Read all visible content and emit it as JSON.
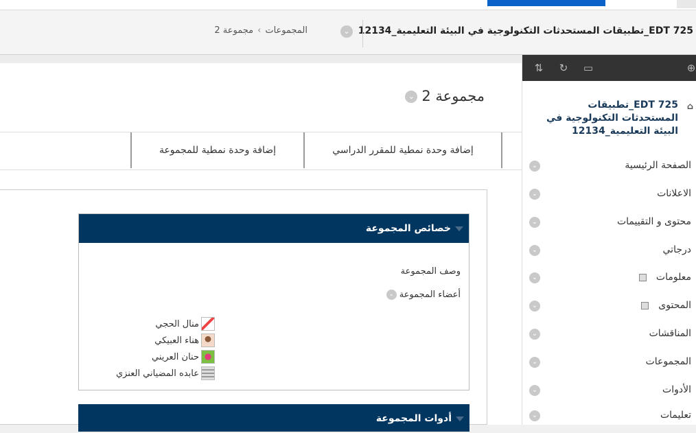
{
  "breadcrumb": {
    "course_title": "EDT 725_تطبيقات المستحدثات التكنولوجية في البيئة التعليمية_12134",
    "trail": [
      "المجموعات",
      "مجموعة 2"
    ],
    "separator": "›"
  },
  "page": {
    "heading": "مجموعة 2"
  },
  "actions": {
    "add_course_module": "إضافة وحدة نمطية للمقرر الدراسي",
    "add_group_module": "إضافة وحدة نمطية للمجموعة"
  },
  "group_properties": {
    "title": "خصائص المجموعة",
    "description_label": "وصف المجموعة",
    "members_label": "أعضاء المجموعة",
    "members": [
      {
        "name": "منال الحجي",
        "avatar": "avatar-icon"
      },
      {
        "name": "هناء العبيكي",
        "avatar": "avatar-icon"
      },
      {
        "name": "حنان العريني",
        "avatar": "avatar-icon"
      },
      {
        "name": "عابده المضياني العنزي",
        "avatar": "avatar-icon"
      }
    ]
  },
  "second_module": {
    "title": "أدوات المجموعة"
  },
  "sidebar": {
    "course_title": "EDT 725_تطبيقات المستحدثات التكنولوجية في البيئة التعليمية_12134",
    "toolbar_icons": [
      "sort-icon",
      "refresh-icon",
      "folder-icon",
      "add-icon"
    ],
    "items": [
      {
        "label": "الصفحة الرئيسية",
        "marker": false
      },
      {
        "label": "الاعلانات",
        "marker": false
      },
      {
        "label": "محتوى و التقييمات",
        "marker": false
      },
      {
        "label": "درجاتي",
        "marker": false
      },
      {
        "label": "معلومات",
        "marker": true
      },
      {
        "label": "المحتوى",
        "marker": true
      },
      {
        "label": "المناقشات",
        "marker": false
      },
      {
        "label": "المجموعات",
        "marker": false
      },
      {
        "label": "الأدوات",
        "marker": false
      },
      {
        "label": "تعليمات",
        "marker": false
      }
    ]
  },
  "colors": {
    "module_header": "#003660",
    "accent": "#0b63c9",
    "sidebar_toolbar": "#333333"
  }
}
